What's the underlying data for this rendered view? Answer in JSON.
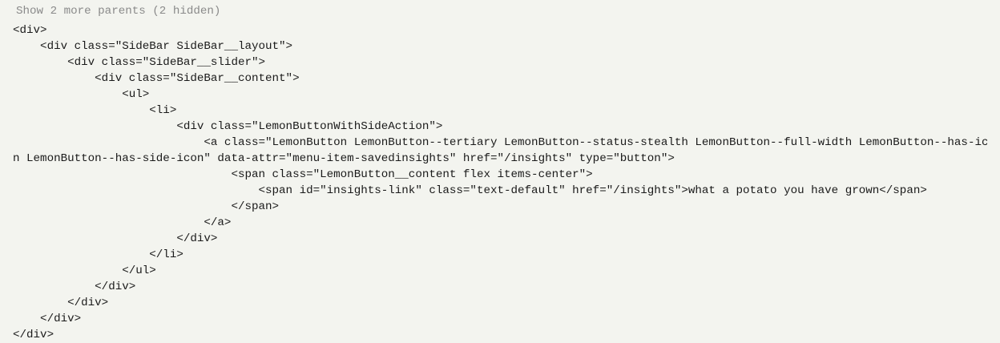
{
  "show_parents": {
    "label": "Show 2 more parents (2 hidden)"
  },
  "code_lines": [
    "<div>",
    "    <div class=\"SideBar SideBar__layout\">",
    "        <div class=\"SideBar__slider\">",
    "            <div class=\"SideBar__content\">",
    "                <ul>",
    "                    <li>",
    "                        <div class=\"LemonButtonWithSideAction\">",
    "                            <a class=\"LemonButton LemonButton--tertiary LemonButton--status-stealth LemonButton--full-width LemonButton--has-ico",
    "n LemonButton--has-side-icon\" data-attr=\"menu-item-savedinsights\" href=\"/insights\" type=\"button\">",
    "                                <span class=\"LemonButton__content flex items-center\">",
    "                                    <span id=\"insights-link\" class=\"text-default\" href=\"/insights\">what a potato you have grown</span>",
    "                                </span>",
    "                            </a>",
    "                        </div>",
    "                    </li>",
    "                </ul>",
    "            </div>",
    "        </div>",
    "    </div>",
    "</div>"
  ]
}
